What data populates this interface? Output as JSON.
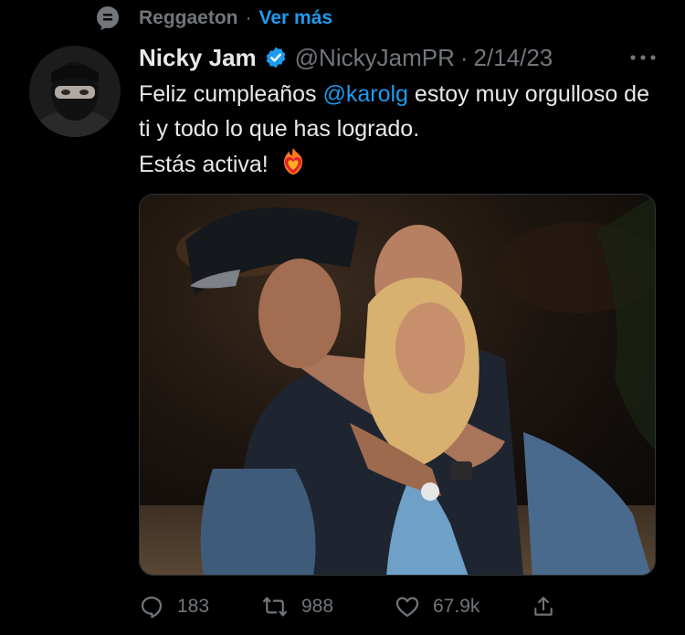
{
  "topic": {
    "icon": "topic-icon",
    "name": "Reggaeton",
    "separator": "·",
    "more_label": "Ver más"
  },
  "tweet": {
    "author_name": "Nicky Jam",
    "verified_icon": "verified-badge-icon",
    "handle": "@NickyJamPR",
    "separator": "·",
    "date": "2/14/23",
    "more_icon": "more-options-icon",
    "text_part1": "Feliz cumpleaños ",
    "mention": "@karolg",
    "text_part2": " estoy muy orgulloso de ti y todo lo que has logrado.",
    "text_part3": "Estás activa!",
    "emoji": "heart-on-fire-emoji"
  },
  "actions": {
    "reply": {
      "icon": "reply-icon",
      "count": "183"
    },
    "retweet": {
      "icon": "retweet-icon",
      "count": "988"
    },
    "like": {
      "icon": "like-icon",
      "count": "67.9k"
    },
    "share": {
      "icon": "share-icon"
    }
  },
  "colors": {
    "background": "#000000",
    "text": "#e7e9ea",
    "muted": "#71767b",
    "accent": "#1d9bf0"
  }
}
